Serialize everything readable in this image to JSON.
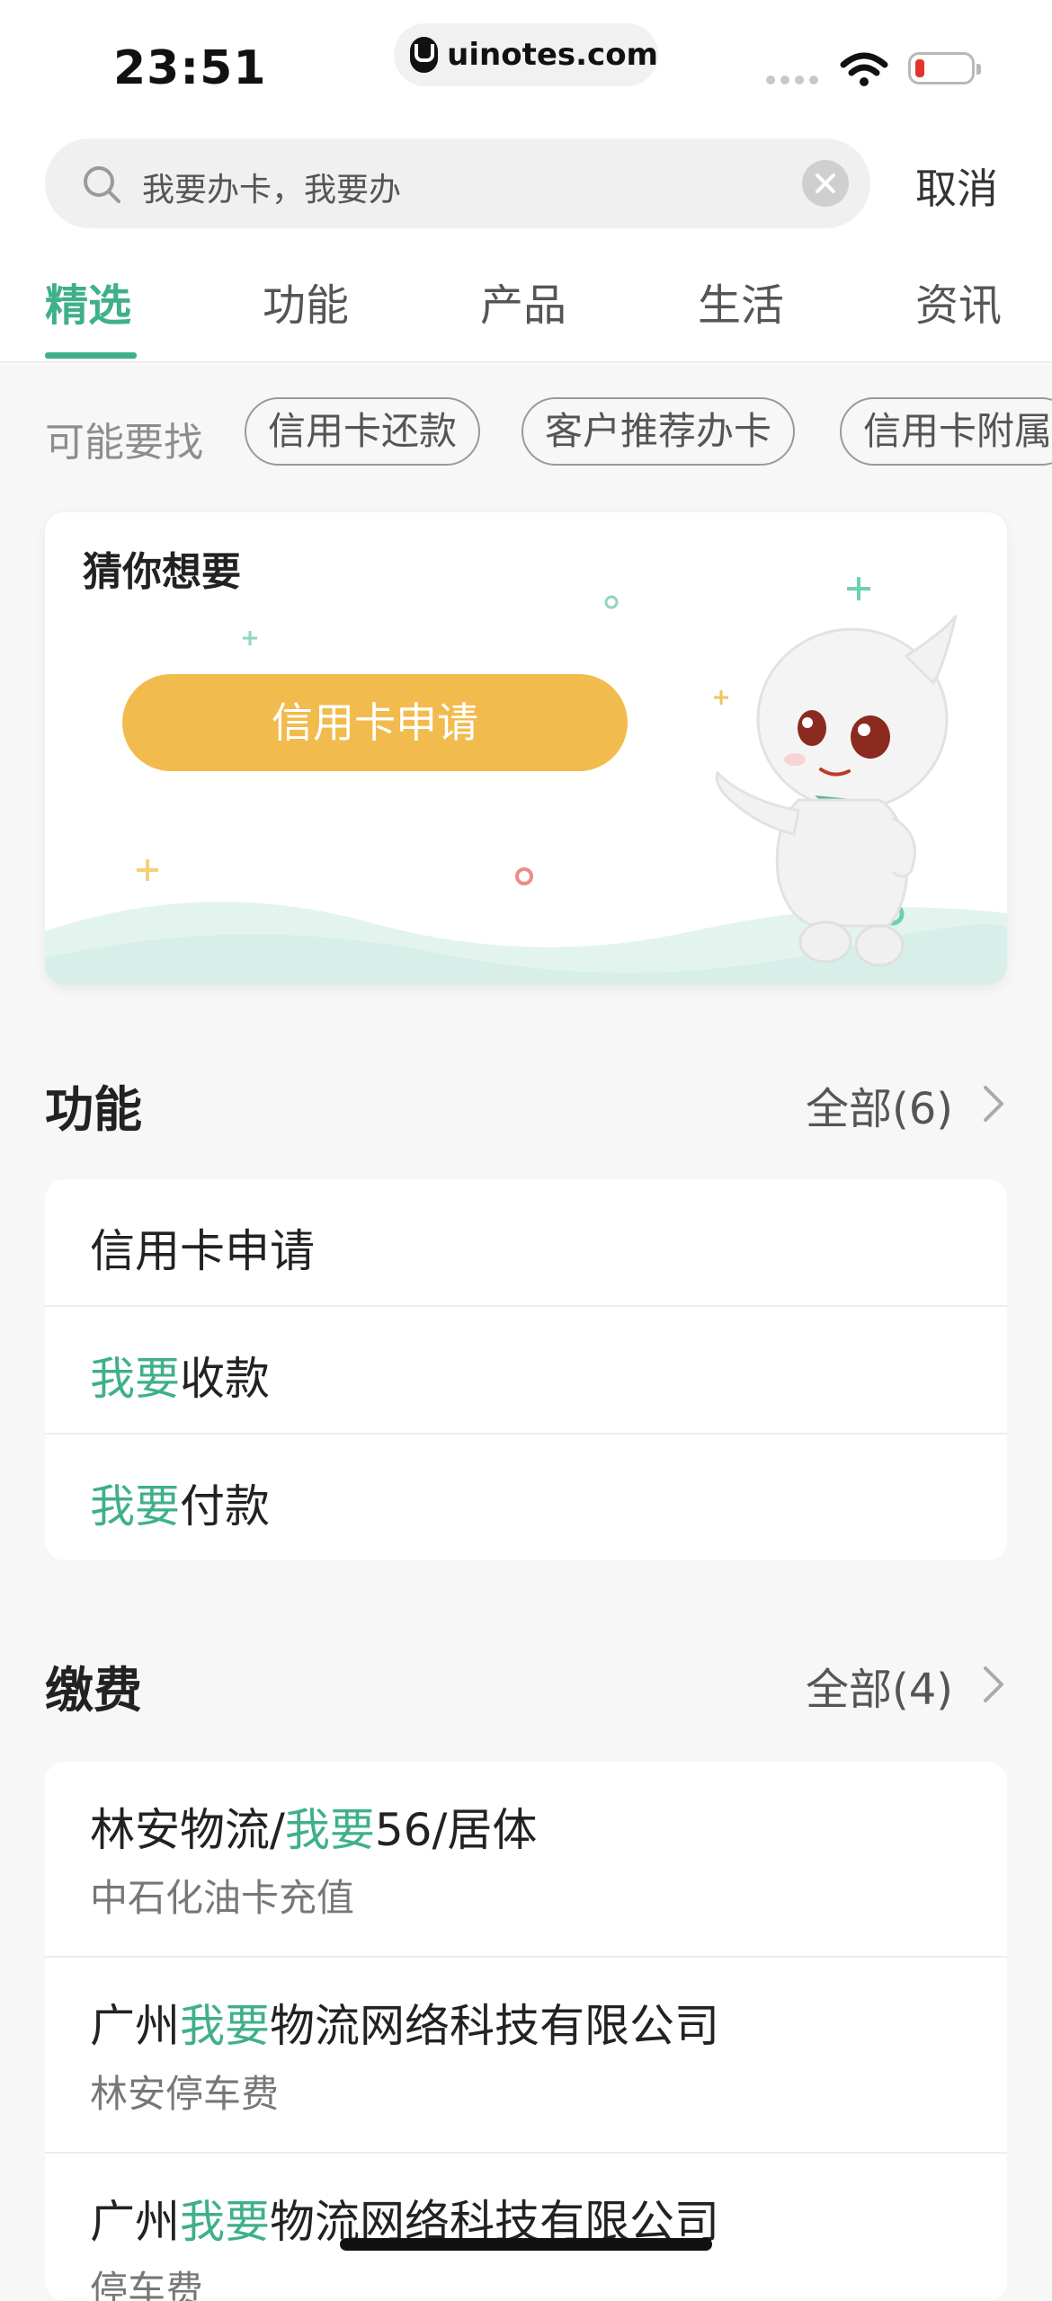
{
  "status_bar": {
    "time": "23:51",
    "url": "uinotes.com",
    "battery_color": "#e0352b"
  },
  "search": {
    "value": "我要办卡，我要办",
    "cancel_label": "取消"
  },
  "tabs": [
    {
      "label": "精选",
      "active": true
    },
    {
      "label": "功能",
      "active": false
    },
    {
      "label": "产品",
      "active": false
    },
    {
      "label": "生活",
      "active": false
    },
    {
      "label": "资讯",
      "active": false
    }
  ],
  "suggestions": {
    "label": "可能要找",
    "chips": [
      "信用卡还款",
      "客户推荐办卡",
      "信用卡附属"
    ]
  },
  "guess": {
    "title": "猜你想要",
    "button_label": "信用卡申请"
  },
  "functions": {
    "title": "功能",
    "more_label": "全部(6)",
    "items": [
      {
        "pre": "",
        "hl": "",
        "post": "信用卡申请"
      },
      {
        "pre": "",
        "hl": "我要",
        "post": "收款"
      },
      {
        "pre": "",
        "hl": "我要",
        "post": "付款"
      }
    ]
  },
  "payments": {
    "title": "缴费",
    "more_label": "全部(4)",
    "items": [
      {
        "pre": "林安物流/",
        "hl": "我要",
        "post": "56/居体",
        "sub": "中石化油卡充值"
      },
      {
        "pre": "广州",
        "hl": "我要",
        "post": "物流网络科技有限公司",
        "sub": "林安停车费"
      },
      {
        "pre": "广州",
        "hl": "我要",
        "post": "物流网络科技有限公司",
        "sub": "停车费"
      }
    ]
  },
  "colors": {
    "accent": "#3fb089",
    "button_yellow": "#f2bb4e"
  }
}
